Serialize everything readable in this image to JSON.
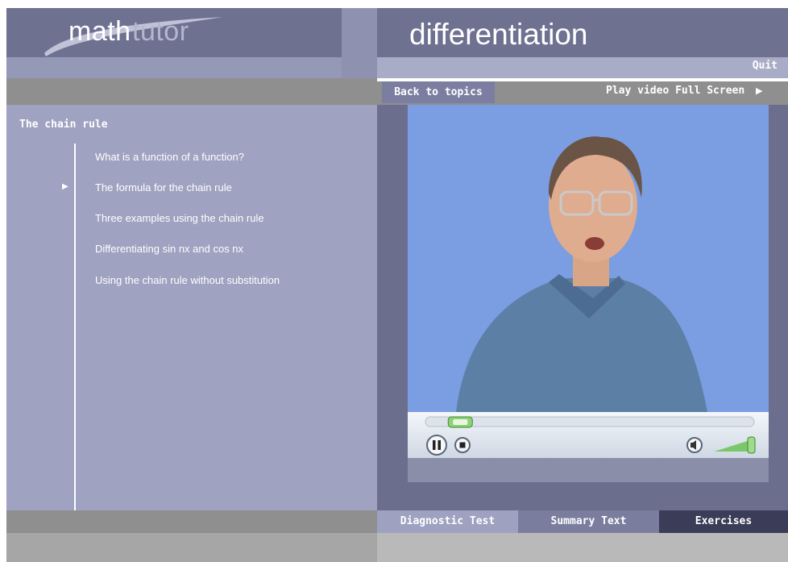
{
  "header": {
    "logo_math": "math",
    "logo_tutor": "tutor",
    "title": "differentiation",
    "quit_label": "Quit"
  },
  "nav": {
    "back_label": "Back to topics",
    "fullscreen_label": "Play video Full Screen"
  },
  "sidebar": {
    "section_title": "The chain rule",
    "topics": [
      {
        "label": "What is a function of a function?",
        "current": false
      },
      {
        "label": "The formula for the chain rule",
        "current": true
      },
      {
        "label": "Three examples using the chain rule",
        "current": false
      },
      {
        "label": "Differentiating sin nx and cos nx",
        "current": false
      },
      {
        "label": "Using the chain rule without substitution",
        "current": false
      }
    ]
  },
  "player": {
    "progress_fraction": 0.09,
    "volume_fraction": 1.0,
    "play_state": "playing"
  },
  "tabs": {
    "diagnostic": "Diagnostic Test",
    "summary": "Summary Text",
    "exercises": "Exercises"
  },
  "colors": {
    "header_bg": "#6e7190",
    "panel_bg": "#9fa2c0",
    "video_bg": "#7a9be0",
    "exercises_tab": "#3b3c57"
  }
}
